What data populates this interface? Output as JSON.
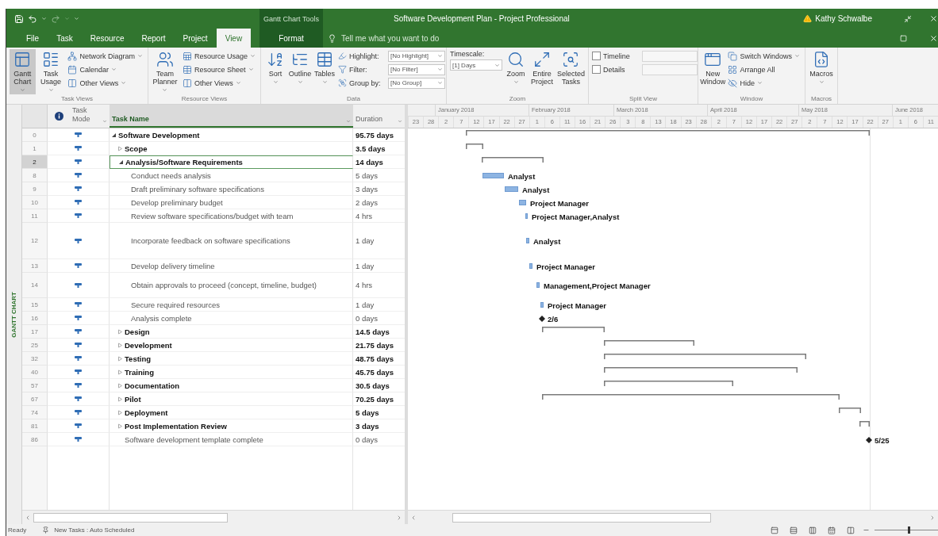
{
  "title_bar": {
    "contextual_group": "Gantt Chart Tools",
    "title": "Software Development Plan - Project Professional",
    "user": "Kathy Schwalbe"
  },
  "tabs": [
    {
      "label": "File",
      "kind": "file",
      "selected": false
    },
    {
      "label": "Task",
      "kind": "normal",
      "selected": false
    },
    {
      "label": "Resource",
      "kind": "normal",
      "selected": false
    },
    {
      "label": "Report",
      "kind": "normal",
      "selected": false
    },
    {
      "label": "Project",
      "kind": "normal",
      "selected": false
    },
    {
      "label": "View",
      "kind": "normal",
      "selected": true
    },
    {
      "label": "Format",
      "kind": "contextual",
      "selected": false
    }
  ],
  "tell_me": {
    "placeholder": "Tell me what you want to do"
  },
  "ribbon": [
    {
      "label": "Task Views",
      "items": [
        {
          "kind": "large",
          "label": "Gantt Chart",
          "selected": true,
          "dropdown": true
        },
        {
          "kind": "large",
          "label": "Task Usage",
          "selected": false,
          "dropdown": true
        },
        {
          "kind": "small",
          "label": "Network Diagram",
          "dropdown": true
        },
        {
          "kind": "small",
          "label": "Calendar",
          "dropdown": true
        },
        {
          "kind": "small",
          "label": "Other Views",
          "dropdown": true
        }
      ]
    },
    {
      "label": "Resource Views",
      "items": [
        {
          "kind": "large",
          "label": "Team Planner",
          "selected": false,
          "dropdown": true
        },
        {
          "kind": "small",
          "label": "Resource Usage",
          "dropdown": true
        },
        {
          "kind": "small",
          "label": "Resource Sheet",
          "dropdown": true
        },
        {
          "kind": "small",
          "label": "Other Views",
          "dropdown": true
        }
      ]
    },
    {
      "label": "Data",
      "items": [
        {
          "kind": "large",
          "label": "Sort",
          "selected": false,
          "dropdown": true
        },
        {
          "kind": "large",
          "label": "Outline",
          "selected": false,
          "dropdown": true
        },
        {
          "kind": "large",
          "label": "Tables",
          "selected": false,
          "dropdown": true
        },
        {
          "kind": "field",
          "label": "Highlight:",
          "value": "[No Highlight]"
        },
        {
          "kind": "field",
          "label": "Filter:",
          "value": "[No Filter]"
        },
        {
          "kind": "field",
          "label": "Group by:",
          "value": "[No Group]"
        }
      ]
    },
    {
      "label": "Zoom",
      "items": [
        {
          "kind": "stack_field",
          "label": "Timescale:",
          "value": "[1] Days"
        },
        {
          "kind": "large",
          "label": "Zoom",
          "selected": false,
          "dropdown": true
        },
        {
          "kind": "large",
          "label": "Entire Project",
          "selected": false,
          "dropdown": false
        },
        {
          "kind": "large",
          "label": "Selected Tasks",
          "selected": false,
          "dropdown": false
        }
      ]
    },
    {
      "label": "Split View",
      "items": [
        {
          "kind": "check",
          "label": "Timeline",
          "checked": false
        },
        {
          "kind": "check",
          "label": "Details",
          "checked": false
        }
      ]
    },
    {
      "label": "Window",
      "items": [
        {
          "kind": "large",
          "label": "New Window",
          "selected": false,
          "dropdown": false
        },
        {
          "kind": "small",
          "label": "Switch Windows",
          "dropdown": true
        },
        {
          "kind": "small",
          "label": "Arrange All",
          "dropdown": false
        },
        {
          "kind": "small",
          "label": "Hide",
          "dropdown": true
        }
      ]
    },
    {
      "label": "Macros",
      "items": [
        {
          "kind": "large",
          "label": "Macros",
          "selected": false,
          "dropdown": true
        }
      ]
    }
  ],
  "view_label": "GANTT CHART",
  "table": {
    "columns": [
      {
        "label": "Task Mode",
        "selected": false
      },
      {
        "label": "Task Name",
        "selected": true
      },
      {
        "label": "Duration",
        "selected": false
      }
    ],
    "tasks": [
      {
        "id": "0",
        "name": "Software Development",
        "duration": "95.75 days",
        "kind": "summary",
        "expanded": true,
        "selected": false,
        "children": [
          {
            "id": "1",
            "name": "Scope",
            "duration": "3.5 days",
            "kind": "summary",
            "expanded": false,
            "selected": false
          },
          {
            "id": "2",
            "name": "Analysis/Software Requirements",
            "duration": "14 days",
            "kind": "summary",
            "expanded": true,
            "selected": true,
            "children": [
              {
                "id": "8",
                "name": "Conduct needs analysis",
                "duration": "5 days",
                "kind": "task",
                "selected": false,
                "gantt_label": "Analyst"
              },
              {
                "id": "9",
                "name": "Draft preliminary software specifications",
                "duration": "3 days",
                "kind": "task",
                "selected": false,
                "gantt_label": "Analyst"
              },
              {
                "id": "10",
                "name": "Develop preliminary budget",
                "duration": "2 days",
                "kind": "task",
                "selected": false,
                "gantt_label": "Project Manager"
              },
              {
                "id": "11",
                "name": "Review software specifications/budget with team",
                "duration": "4 hrs",
                "kind": "task",
                "selected": false,
                "gantt_label": "Project Manager,Analyst"
              },
              {
                "id": "12",
                "name": "Incorporate feedback on software specifications",
                "duration": "1 day",
                "kind": "task",
                "selected": false,
                "gantt_label": "Analyst"
              },
              {
                "id": "13",
                "name": "Develop delivery timeline",
                "duration": "1 day",
                "kind": "task",
                "selected": false,
                "gantt_label": "Project Manager"
              },
              {
                "id": "14",
                "name": "Obtain approvals to proceed (concept, timeline, budget)",
                "duration": "4 hrs",
                "kind": "task",
                "selected": false,
                "gantt_label": "Management,Project Manager"
              },
              {
                "id": "15",
                "name": "Secure required resources",
                "duration": "1 day",
                "kind": "task",
                "selected": false,
                "gantt_label": "Project Manager"
              },
              {
                "id": "16",
                "name": "Analysis complete",
                "duration": "0 days",
                "kind": "milestone",
                "selected": false,
                "gantt_label": "2/6"
              }
            ]
          },
          {
            "id": "17",
            "name": "Design",
            "duration": "14.5 days",
            "kind": "summary",
            "expanded": false,
            "selected": false
          },
          {
            "id": "25",
            "name": "Development",
            "duration": "21.75 days",
            "kind": "summary",
            "expanded": false,
            "selected": false
          },
          {
            "id": "32",
            "name": "Testing",
            "duration": "48.75 days",
            "kind": "summary",
            "expanded": false,
            "selected": false
          },
          {
            "id": "40",
            "name": "Training",
            "duration": "45.75 days",
            "kind": "summary",
            "expanded": false,
            "selected": false
          },
          {
            "id": "57",
            "name": "Documentation",
            "duration": "30.5 days",
            "kind": "summary",
            "expanded": false,
            "selected": false
          },
          {
            "id": "67",
            "name": "Pilot",
            "duration": "70.25 days",
            "kind": "summary",
            "expanded": false,
            "selected": false
          },
          {
            "id": "74",
            "name": "Deployment",
            "duration": "5 days",
            "kind": "summary",
            "expanded": false,
            "selected": false
          },
          {
            "id": "81",
            "name": "Post Implementation Review",
            "duration": "3 days",
            "kind": "summary",
            "expanded": false,
            "selected": false
          },
          {
            "id": "86",
            "name": "Software development template complete",
            "duration": "0 days",
            "kind": "milestone",
            "selected": false,
            "gantt_label": "5/25"
          }
        ]
      }
    ]
  },
  "timescale": {
    "months": [
      "January 2018",
      "February 2018",
      "March 2018",
      "April 2018",
      "May 2018",
      "June 2018"
    ],
    "days": [
      "23",
      "28",
      "2",
      "7",
      "12",
      "17",
      "22",
      "27",
      "1",
      "6",
      "11",
      "16",
      "21",
      "26",
      "3",
      "8",
      "13",
      "18",
      "23",
      "28",
      "2",
      "7",
      "12",
      "17",
      "22",
      "27",
      "2",
      "7",
      "12",
      "17",
      "22",
      "27",
      "1",
      "6",
      "11"
    ]
  },
  "status_bar": {
    "ready": "Ready",
    "new_tasks": "New Tasks : Auto Scheduled",
    "zoom": {
      "level": 0.54
    }
  }
}
